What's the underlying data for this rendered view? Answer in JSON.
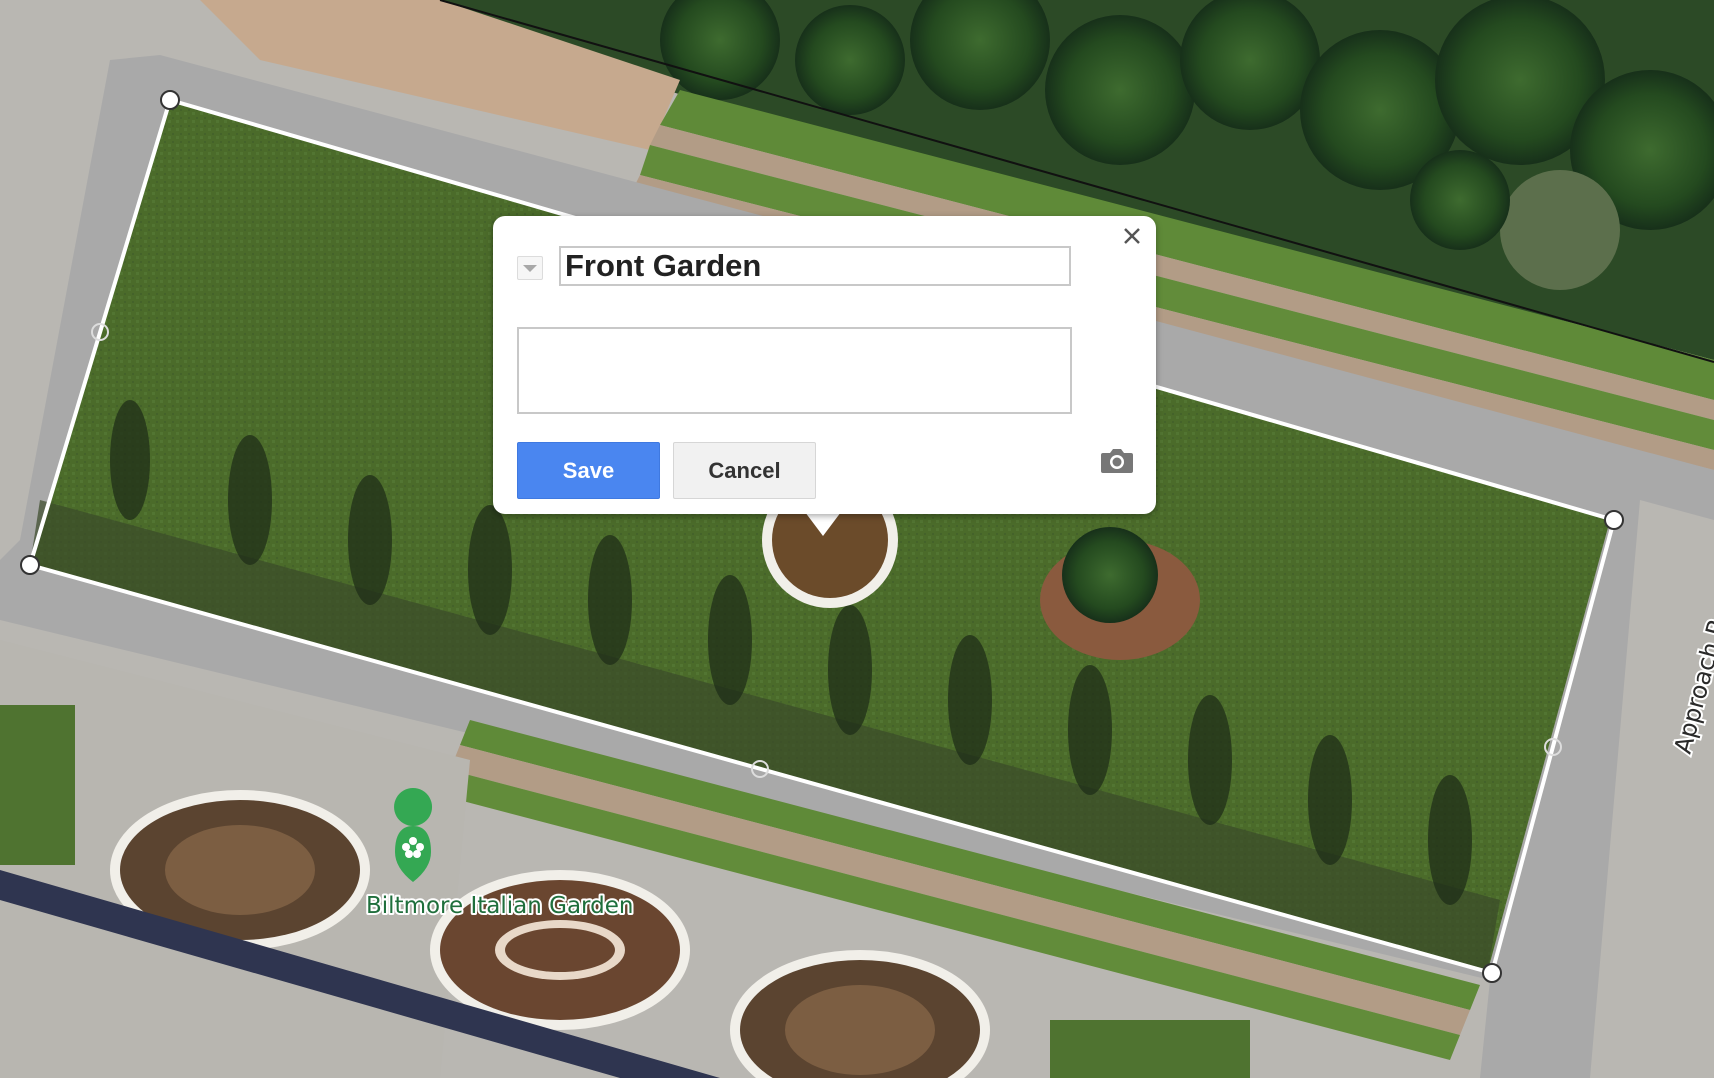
{
  "map": {
    "place_label": "Biltmore Italian Garden",
    "road_label": "Approach R",
    "place_marker_icon": "flower-icon",
    "polygon_color": "#ffffff"
  },
  "info_window": {
    "close_icon": "close-icon",
    "style_icon": "dropdown-triangle-icon",
    "title_value": "Front Garden",
    "description_value": "",
    "save_label": "Save",
    "cancel_label": "Cancel",
    "camera_icon": "camera-icon",
    "colors": {
      "save_button": "#4a86f0",
      "cancel_button": "#f1f1f1",
      "marker": "#34a853"
    }
  }
}
